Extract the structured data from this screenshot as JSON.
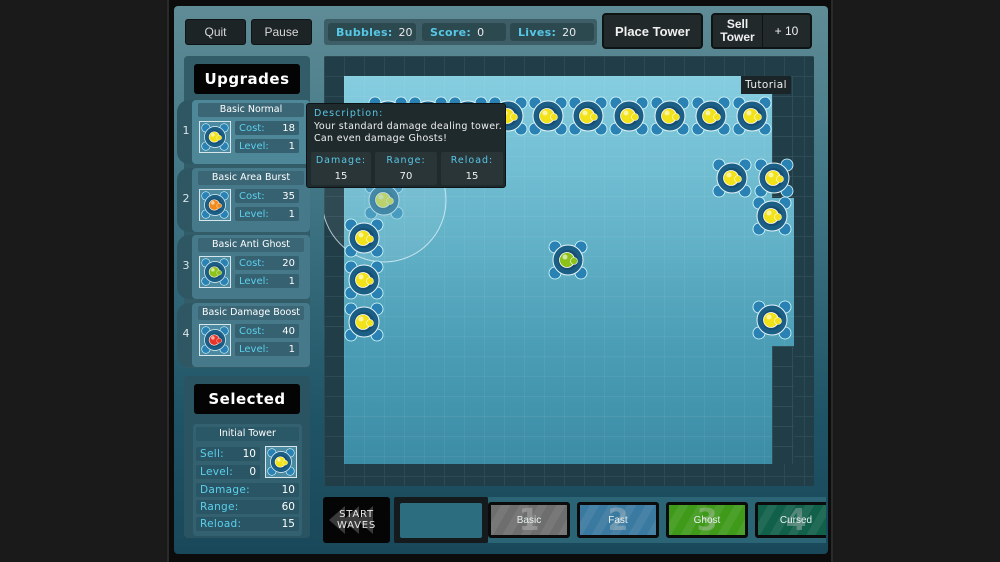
{
  "header": {
    "quit_label": "Quit",
    "pause_label": "Pause",
    "stats": [
      {
        "label": "Bubbles:",
        "value": "20"
      },
      {
        "label": "Score:",
        "value": "0"
      },
      {
        "label": "Lives:",
        "value": "20"
      }
    ],
    "place_tower_label": "Place Tower",
    "sell_tower_label_line1": "Sell",
    "sell_tower_label_line2": "Tower",
    "sell_value_label": "+ 10"
  },
  "upgrades": {
    "title": "Upgrades",
    "items": [
      {
        "number": "1",
        "name": "Basic Normal",
        "cost_label": "Cost:",
        "cost": "18",
        "level_label": "Level:",
        "level": "1",
        "icon": "basic-normal-tower-icon",
        "color": "#f2e21a"
      },
      {
        "number": "2",
        "name": "Basic Area Burst",
        "cost_label": "Cost:",
        "cost": "35",
        "level_label": "Level:",
        "level": "1",
        "icon": "area-burst-tower-icon",
        "color": "#f08a1c"
      },
      {
        "number": "3",
        "name": "Basic Anti Ghost",
        "cost_label": "Cost:",
        "cost": "20",
        "level_label": "Level:",
        "level": "1",
        "icon": "anti-ghost-tower-icon",
        "color": "#8cc21a"
      },
      {
        "number": "4",
        "name": "Basic Damage Boost",
        "cost_label": "Cost:",
        "cost": "40",
        "level_label": "Level:",
        "level": "1",
        "icon": "damage-boost-tower-icon",
        "color": "#e8352a"
      }
    ]
  },
  "selected": {
    "title": "Selected",
    "name": "Initial Tower",
    "sell_label": "Sell:",
    "sell": "10",
    "level_label": "Level:",
    "level": "0",
    "damage_label": "Damage:",
    "damage": "10",
    "range_label": "Range:",
    "range": "60",
    "reload_label": "Reload:",
    "reload": "15"
  },
  "map": {
    "tutorial_label": "Tutorial"
  },
  "tooltip": {
    "title": "Description:",
    "description": "Your standard damage dealing tower.  Can even damage Ghosts!",
    "damage_label": "Damage:",
    "damage": "15",
    "range_label": "Range:",
    "range": "70",
    "reload_label": "Reload:",
    "reload": "15"
  },
  "bottom": {
    "start_waves_line1": "START",
    "start_waves_line2": "WAVES",
    "waves": [
      {
        "number": "1",
        "name": "Basic",
        "color": "#6e6e6e"
      },
      {
        "number": "2",
        "name": "Fast",
        "color": "#3a7aa0"
      },
      {
        "number": "3",
        "name": "Ghost",
        "color": "#3f9a1a"
      },
      {
        "number": "4",
        "name": "Cursed",
        "color": "#11604a"
      }
    ]
  },
  "colors": {
    "accent_text": "#57c7e6",
    "tower_yellow": "#f2e21a",
    "tower_blue": "#1c6c96"
  }
}
